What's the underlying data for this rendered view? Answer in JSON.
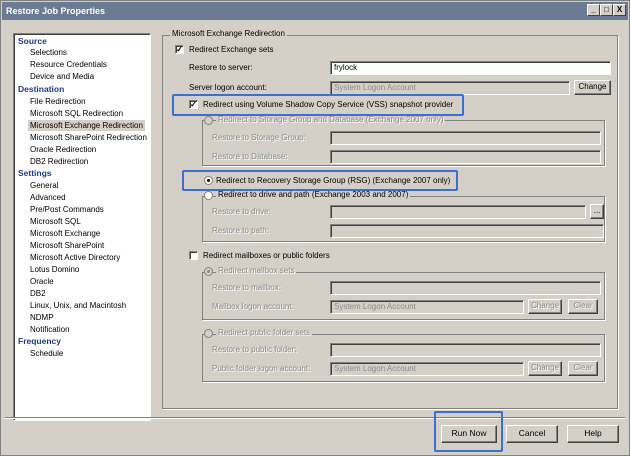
{
  "window": {
    "title": "Restore Job Properties",
    "min_label": "_",
    "max_label": "□",
    "close_label": "X"
  },
  "tree": {
    "categories": [
      {
        "label": "Source",
        "items": [
          "Selections",
          "Resource Credentials",
          "Device and Media"
        ]
      },
      {
        "label": "Destination",
        "items": [
          "File Redirection",
          "Microsoft SQL Redirection",
          "Microsoft Exchange Redirection",
          "Microsoft SharePoint Redirection",
          "Oracle Redirection",
          "DB2 Redirection"
        ]
      },
      {
        "label": "Settings",
        "items": [
          "General",
          "Advanced",
          "Pre/Post Commands",
          "Microsoft SQL",
          "Microsoft Exchange",
          "Microsoft SharePoint",
          "Microsoft Active Directory",
          "Lotus Domino",
          "Oracle",
          "DB2",
          "Linux, Unix, and Macintosh",
          "NDMP",
          "Notification"
        ]
      },
      {
        "label": "Frequency",
        "items": [
          "Schedule"
        ]
      }
    ],
    "selected": "Microsoft Exchange Redirection"
  },
  "panel": {
    "group_title": "Microsoft Exchange Redirection",
    "redirect_exchange_sets": {
      "label": "Redirect Exchange sets",
      "checked": true
    },
    "restore_to_server": {
      "label": "Restore to server:",
      "value": "frylock"
    },
    "server_logon": {
      "label": "Server logon account:",
      "value": "System Logon Account",
      "button": "Change"
    },
    "vss": {
      "label": "Redirect using Volume Shadow Copy Service (VSS) snapshot provider",
      "checked": true
    },
    "storage_group": {
      "label": "Redirect to Storage Group and Database (Exchange 2007 only)",
      "restore_sg_label": "Restore to Storage Group:",
      "restore_db_label": "Restore to Database:"
    },
    "rsg": {
      "label": "Redirect to Recovery Storage Group (RSG) (Exchange 2007 only)",
      "selected": true
    },
    "drive_path": {
      "label": "Redirect to drive and path (Exchange 2003 and 2007)",
      "drive_label": "Restore to drive:",
      "path_label": "Restore to path:",
      "browse": "..."
    },
    "mailboxes": {
      "label": "Redirect mailboxes or public folders",
      "checked": false
    },
    "mailbox_sets": {
      "label": "Redirect mailbox sets",
      "restore_label": "Restore to mailbox:",
      "logon_label": "Mailbox logon account:",
      "logon_value": "System Logon Account",
      "change": "Change",
      "clear": "Clear"
    },
    "public_folder_sets": {
      "label": "Redirect public folder sets",
      "restore_label": "Restore to public folder:",
      "logon_label": "Public folder logon account:",
      "logon_value": "System Logon Account",
      "change": "Change",
      "clear": "Clear"
    }
  },
  "footer": {
    "run_now": "Run Now",
    "cancel": "Cancel",
    "help": "Help"
  },
  "colors": {
    "highlight": "#3b6fd1",
    "titlebar": "#6b7b93",
    "category": "#1f3a8a"
  }
}
